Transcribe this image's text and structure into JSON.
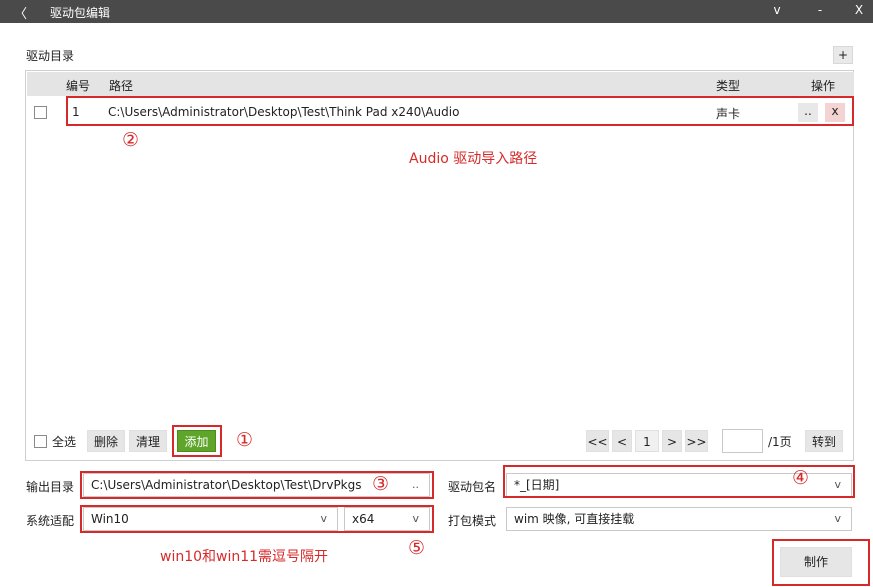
{
  "window": {
    "back_glyph": "〈",
    "title": "驱动包编辑",
    "minimize_glyph": "v",
    "restore_glyph": "-",
    "close_glyph": "X"
  },
  "driver_dir": {
    "label": "驱动目录",
    "add_glyph": "+",
    "columns": {
      "index": "编号",
      "path": "路径",
      "type": "类型",
      "action": "操作"
    },
    "rows": [
      {
        "index": "1",
        "path": "C:\\Users\\Administrator\\Desktop\\Test\\Think Pad x240\\Audio",
        "type": "声卡",
        "browse_label": "..",
        "remove_label": "x"
      }
    ]
  },
  "annotations": {
    "n1": "①",
    "n2": "②",
    "n3": "③",
    "n4": "④",
    "n5": "⑤",
    "audio_note": "Audio 驱动导入路径",
    "win_note": "win10和win11需逗号隔开"
  },
  "toolbar": {
    "select_all": "全选",
    "delete": "删除",
    "clear": "清理",
    "add": "添加"
  },
  "pager": {
    "first": "<<",
    "prev": "<",
    "current": "1",
    "next": ">",
    "last": ">>",
    "goto_value": "",
    "total": "/1页",
    "goto": "转到"
  },
  "output": {
    "label": "输出目录",
    "value": "C:\\Users\\Administrator\\Desktop\\Test\\DrvPkgs",
    "browse_label": ".."
  },
  "package_name": {
    "label": "驱动包名",
    "value": "*_[日期]"
  },
  "system": {
    "label": "系统适配",
    "os_value": "Win10",
    "arch_value": "x64"
  },
  "pack_mode": {
    "label": "打包模式",
    "value": "wim 映像, 可直接挂载"
  },
  "make_button": "制作",
  "chevron_glyph": "v",
  "colors": {
    "titlebar": "#4a4a4a",
    "annotation_red": "#d62a2a",
    "add_green": "#5fa52a"
  }
}
